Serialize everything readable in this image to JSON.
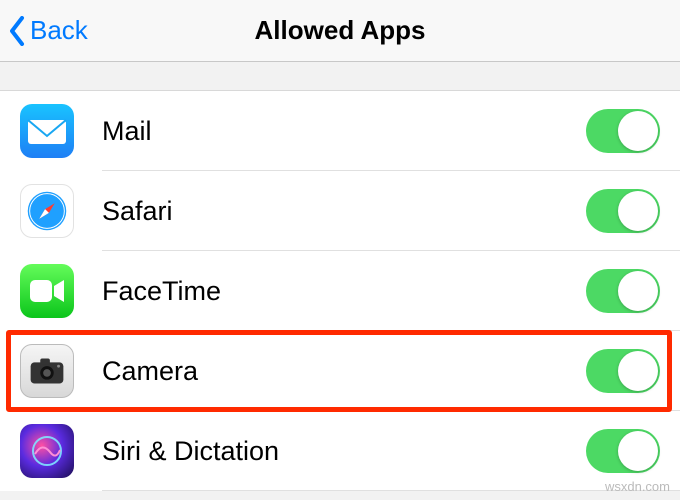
{
  "navbar": {
    "back_label": "Back",
    "title": "Allowed Apps"
  },
  "list": {
    "items": [
      {
        "label": "Mail",
        "icon": "mail-icon",
        "on": true
      },
      {
        "label": "Safari",
        "icon": "safari-icon",
        "on": true
      },
      {
        "label": "FaceTime",
        "icon": "facetime-icon",
        "on": true
      },
      {
        "label": "Camera",
        "icon": "camera-icon",
        "on": true
      },
      {
        "label": "Siri & Dictation",
        "icon": "siri-icon",
        "on": true
      }
    ]
  },
  "watermark": "wsxdn.com",
  "colors": {
    "link": "#007aff",
    "toggle_on": "#4cd964",
    "highlight": "#ff2a00"
  }
}
